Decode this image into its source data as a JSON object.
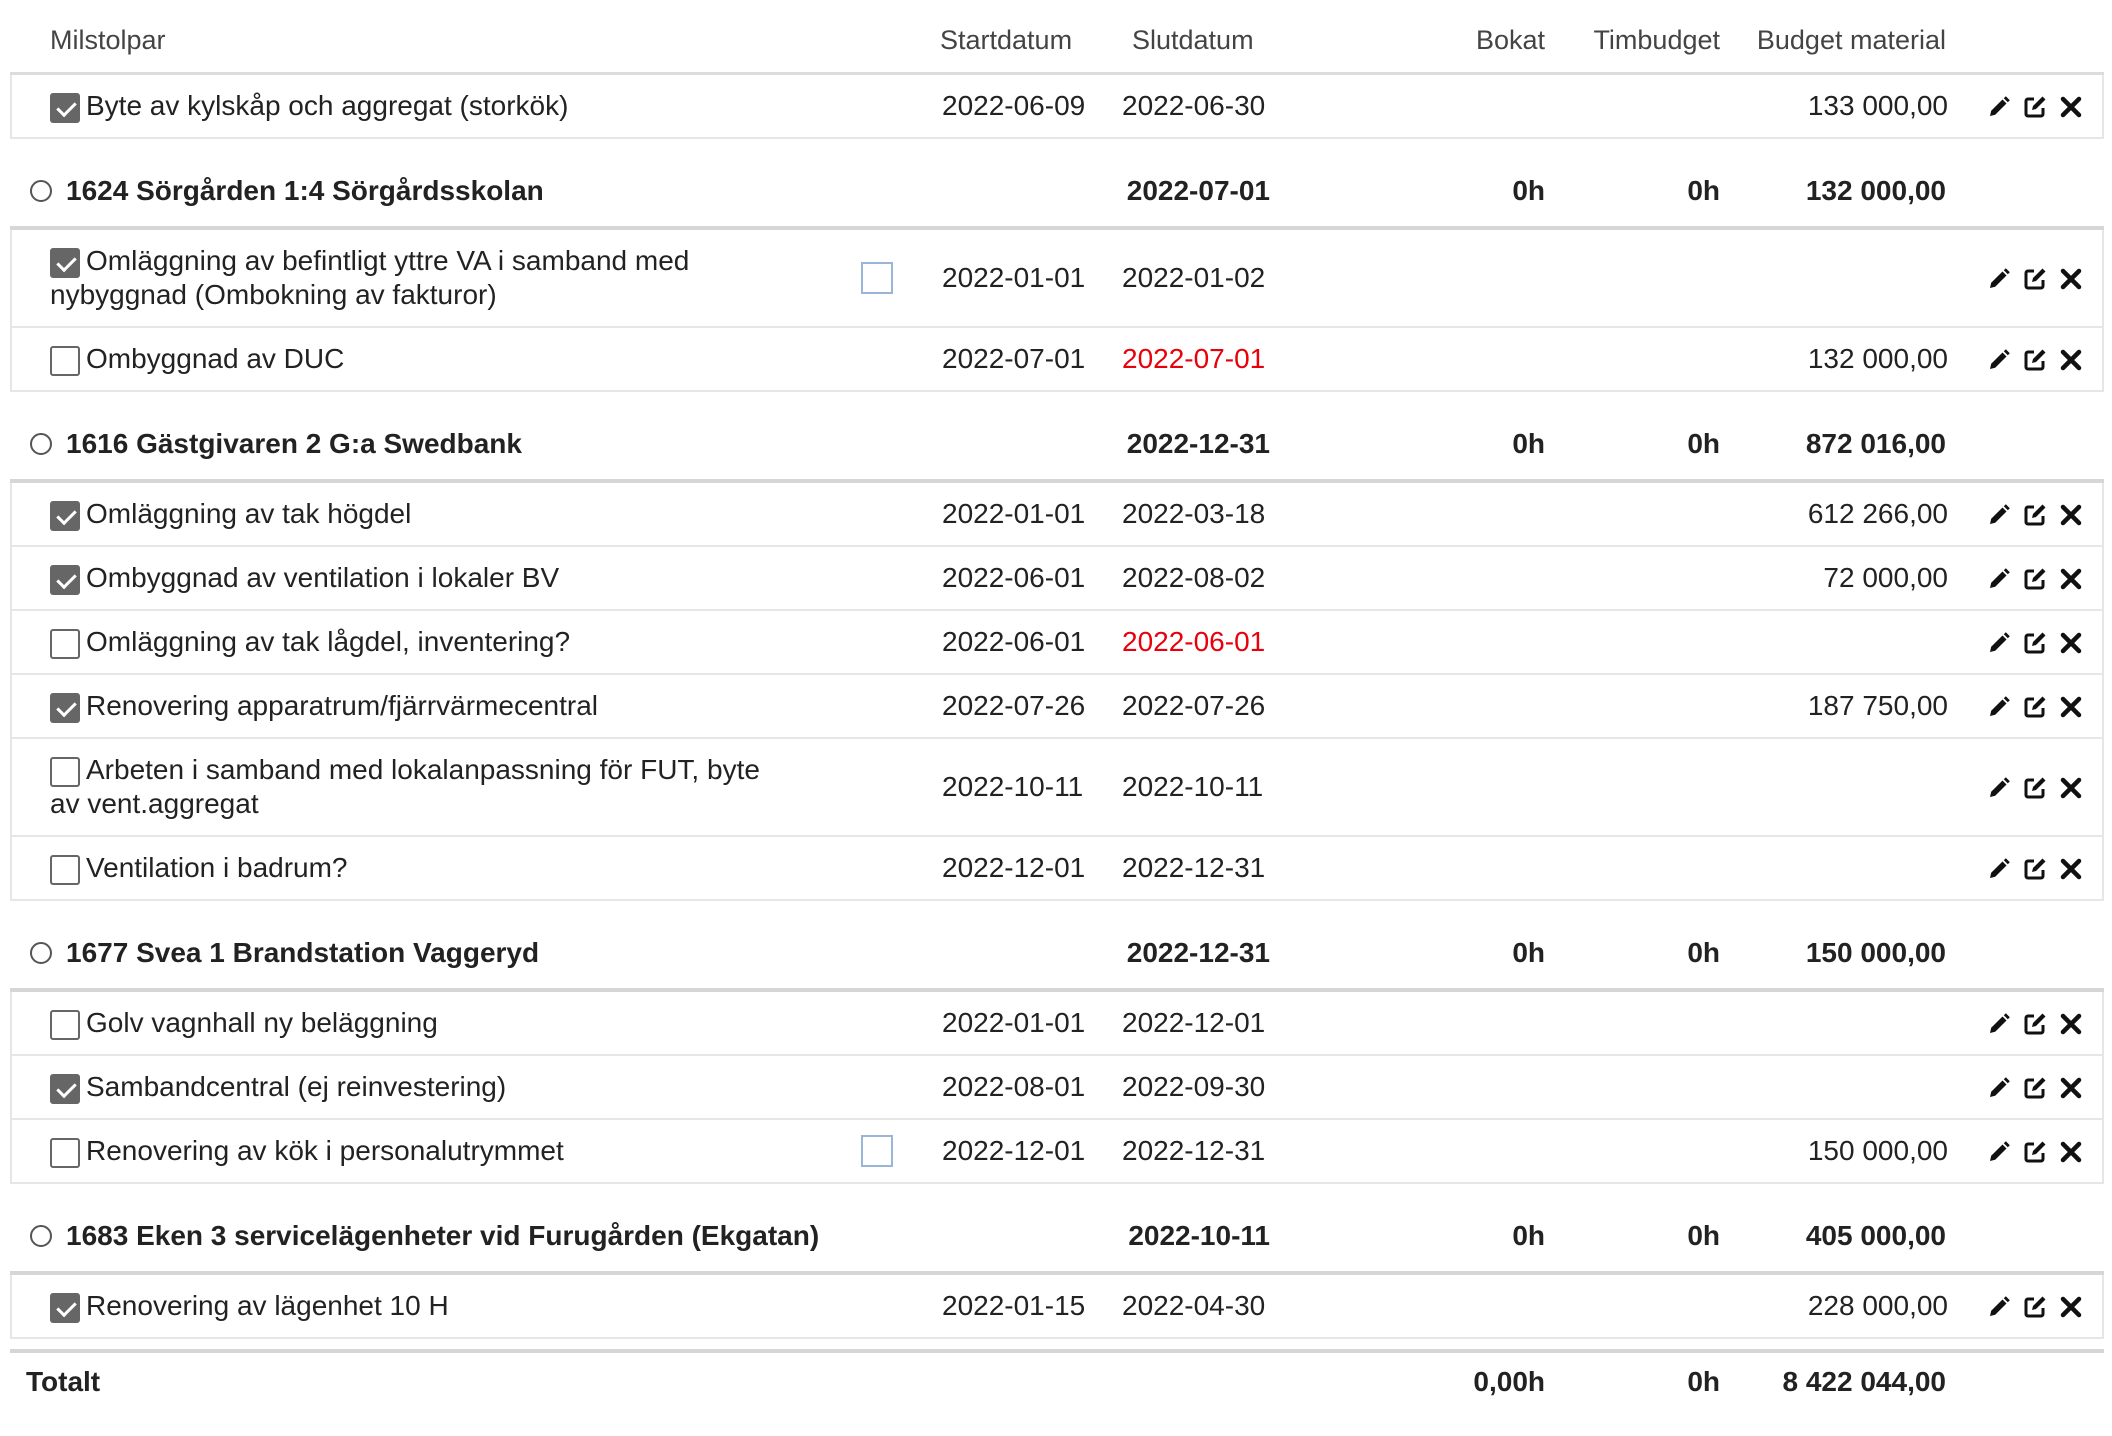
{
  "header": {
    "milestone": "Milstolpar",
    "start": "Startdatum",
    "end": "Slutdatum",
    "booked": "Bokat",
    "hour_budget": "Timbudget",
    "material_budget": "Budget material"
  },
  "top_task": {
    "label": "Byte av kylskåp och aggregat (storkök)",
    "checked": true,
    "start": "2022-06-09",
    "end": "2022-06-30",
    "budget": "133 000,00"
  },
  "groups": [
    {
      "title": "1624 Sörgården 1:4 Sörgårdsskolan",
      "end": "2022-07-01",
      "booked": "0h",
      "hour_budget": "0h",
      "material_budget": "132 000,00",
      "tasks": [
        {
          "label": "Omläggning av befintligt yttre VA i samband med nybyggnad (Ombokning av fakturor)",
          "checked": true,
          "flag": true,
          "start": "2022-01-01",
          "end": "2022-01-02",
          "end_overdue": false,
          "budget": ""
        },
        {
          "label": "Ombyggnad av DUC",
          "checked": false,
          "flag": false,
          "start": "2022-07-01",
          "end": "2022-07-01",
          "end_overdue": true,
          "budget": "132 000,00"
        }
      ]
    },
    {
      "title": "1616 Gästgivaren 2 G:a Swedbank",
      "end": "2022-12-31",
      "booked": "0h",
      "hour_budget": "0h",
      "material_budget": "872 016,00",
      "tasks": [
        {
          "label": "Omläggning av tak högdel",
          "checked": true,
          "flag": false,
          "start": "2022-01-01",
          "end": "2022-03-18",
          "end_overdue": false,
          "budget": "612 266,00"
        },
        {
          "label": "Ombyggnad av ventilation i lokaler BV",
          "checked": true,
          "flag": false,
          "start": "2022-06-01",
          "end": "2022-08-02",
          "end_overdue": false,
          "budget": "72 000,00"
        },
        {
          "label": "Omläggning av tak lågdel, inventering?",
          "checked": false,
          "flag": false,
          "start": "2022-06-01",
          "end": "2022-06-01",
          "end_overdue": true,
          "budget": ""
        },
        {
          "label": "Renovering apparatrum/fjärrvärmecentral",
          "checked": true,
          "flag": false,
          "start": "2022-07-26",
          "end": "2022-07-26",
          "end_overdue": false,
          "budget": "187 750,00"
        },
        {
          "label": "Arbeten i samband med lokalanpassning för FUT, byte av vent.aggregat",
          "checked": false,
          "flag": false,
          "start": "2022-10-11",
          "end": "2022-10-11",
          "end_overdue": false,
          "budget": ""
        },
        {
          "label": "Ventilation i badrum?",
          "checked": false,
          "flag": false,
          "start": "2022-12-01",
          "end": "2022-12-31",
          "end_overdue": false,
          "budget": ""
        }
      ]
    },
    {
      "title": "1677 Svea 1 Brandstation Vaggeryd",
      "end": "2022-12-31",
      "booked": "0h",
      "hour_budget": "0h",
      "material_budget": "150 000,00",
      "tasks": [
        {
          "label": "Golv vagnhall ny beläggning",
          "checked": false,
          "flag": false,
          "start": "2022-01-01",
          "end": "2022-12-01",
          "end_overdue": false,
          "budget": ""
        },
        {
          "label": "Sambandcentral (ej reinvestering)",
          "checked": true,
          "flag": false,
          "start": "2022-08-01",
          "end": "2022-09-30",
          "end_overdue": false,
          "budget": ""
        },
        {
          "label": "Renovering av kök i personalutrymmet",
          "checked": false,
          "flag": true,
          "start": "2022-12-01",
          "end": "2022-12-31",
          "end_overdue": false,
          "budget": "150 000,00"
        }
      ]
    },
    {
      "title": "1683 Eken 3 servicelägenheter vid Furugården (Ekgatan)",
      "end": "2022-10-11",
      "booked": "0h",
      "hour_budget": "0h",
      "material_budget": "405 000,00",
      "tasks": [
        {
          "label": "Renovering av lägenhet 10 H",
          "checked": true,
          "flag": false,
          "start": "2022-01-15",
          "end": "2022-04-30",
          "end_overdue": false,
          "budget": "228 000,00"
        }
      ]
    }
  ],
  "total": {
    "label": "Totalt",
    "booked": "0,00h",
    "hour_budget": "0h",
    "material_budget": "8 422 044,00"
  },
  "colors": {
    "overdue": "#e8000b",
    "checkbox_checked": "#666666",
    "flag_border": "#9ab6d6"
  },
  "icons": [
    "pencil-icon",
    "edit-square-icon",
    "close-icon"
  ]
}
